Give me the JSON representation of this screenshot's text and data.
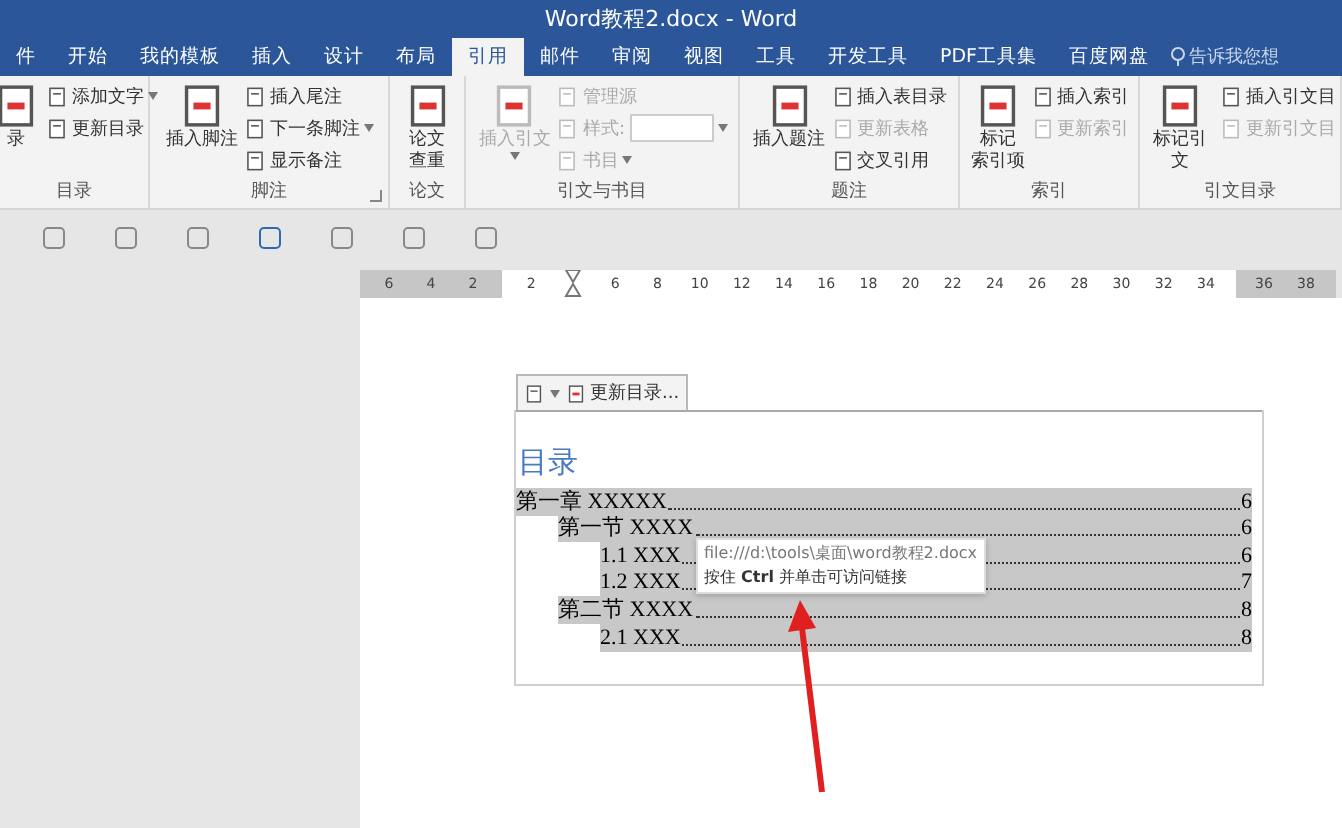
{
  "window": {
    "title": "Word教程2.docx - Word"
  },
  "tabs": [
    {
      "label": "件",
      "selected": false
    },
    {
      "label": "开始",
      "selected": false
    },
    {
      "label": "我的模板",
      "selected": false
    },
    {
      "label": "插入",
      "selected": false
    },
    {
      "label": "设计",
      "selected": false
    },
    {
      "label": "布局",
      "selected": false
    },
    {
      "label": "引用",
      "selected": true
    },
    {
      "label": "邮件",
      "selected": false
    },
    {
      "label": "审阅",
      "selected": false
    },
    {
      "label": "视图",
      "selected": false
    },
    {
      "label": "工具",
      "selected": false
    },
    {
      "label": "开发工具",
      "selected": false
    },
    {
      "label": "PDF工具集",
      "selected": false
    },
    {
      "label": "百度网盘",
      "selected": false
    }
  ],
  "tell_me": {
    "label": "告诉我您想"
  },
  "ribbon": {
    "groups": [
      {
        "label": "目录",
        "launcher": false,
        "items": [
          {
            "kind": "large",
            "lines": [
              "录"
            ],
            "disabled": false,
            "dropdown": false
          },
          {
            "kind": "small",
            "lines": [
              "添加文字"
            ],
            "disabled": false,
            "dropdown": true
          },
          {
            "kind": "small",
            "lines": [
              "更新目录"
            ],
            "disabled": false,
            "dropdown": false
          }
        ]
      },
      {
        "label": "脚注",
        "launcher": true,
        "items": [
          {
            "kind": "large",
            "lines": [
              "插入脚注"
            ],
            "disabled": false,
            "dropdown": false
          },
          {
            "kind": "small",
            "lines": [
              "插入尾注"
            ],
            "disabled": false,
            "dropdown": false
          },
          {
            "kind": "small",
            "lines": [
              "下一条脚注"
            ],
            "disabled": false,
            "dropdown": true
          },
          {
            "kind": "small",
            "lines": [
              "显示备注"
            ],
            "disabled": false,
            "dropdown": false
          }
        ]
      },
      {
        "label": "论文",
        "launcher": false,
        "items": [
          {
            "kind": "large",
            "lines": [
              "论文",
              "查重"
            ],
            "disabled": false,
            "dropdown": false
          }
        ]
      },
      {
        "label": "引文与书目",
        "launcher": false,
        "items": [
          {
            "kind": "large",
            "lines": [
              "插入引文"
            ],
            "disabled": true,
            "dropdown": true
          },
          {
            "kind": "small",
            "lines": [
              "管理源"
            ],
            "disabled": true,
            "dropdown": false
          },
          {
            "kind": "combo",
            "lines": [
              "样式:"
            ],
            "disabled": true,
            "dropdown": true
          },
          {
            "kind": "small",
            "lines": [
              "书目"
            ],
            "disabled": true,
            "dropdown": true
          }
        ]
      },
      {
        "label": "题注",
        "launcher": false,
        "items": [
          {
            "kind": "large",
            "lines": [
              "插入题注"
            ],
            "disabled": false,
            "dropdown": false
          },
          {
            "kind": "small",
            "lines": [
              "插入表目录"
            ],
            "disabled": false,
            "dropdown": false
          },
          {
            "kind": "small",
            "lines": [
              "更新表格"
            ],
            "disabled": true,
            "dropdown": false
          },
          {
            "kind": "small",
            "lines": [
              "交叉引用"
            ],
            "disabled": false,
            "dropdown": false
          }
        ]
      },
      {
        "label": "索引",
        "launcher": false,
        "items": [
          {
            "kind": "large",
            "lines": [
              "标记",
              "索引项"
            ],
            "disabled": false,
            "dropdown": false
          },
          {
            "kind": "small",
            "lines": [
              "插入索引"
            ],
            "disabled": false,
            "dropdown": false
          },
          {
            "kind": "small",
            "lines": [
              "更新索引"
            ],
            "disabled": true,
            "dropdown": false
          }
        ]
      },
      {
        "label": "引文目录",
        "launcher": false,
        "items": [
          {
            "kind": "large",
            "lines": [
              "标记引文"
            ],
            "disabled": false,
            "dropdown": false
          },
          {
            "kind": "small",
            "lines": [
              "插入引文目"
            ],
            "disabled": false,
            "dropdown": false
          },
          {
            "kind": "small",
            "lines": [
              "更新引文目"
            ],
            "disabled": true,
            "dropdown": false
          }
        ]
      }
    ]
  },
  "ruler": {
    "left_ticks": [
      "6",
      "4",
      "2"
    ],
    "ticks": [
      "2",
      "6",
      "8",
      "10",
      "12",
      "14",
      "16",
      "18",
      "20",
      "22",
      "24",
      "26",
      "28",
      "30",
      "32",
      "34"
    ],
    "right_ticks": [
      "36",
      "38"
    ]
  },
  "document": {
    "toc_toolbar": {
      "label": "更新目录..."
    },
    "heading": "目录",
    "toc": [
      {
        "text": "第一章  XXXXX",
        "page": "6",
        "children": [
          {
            "text": "第一节  XXXX",
            "page": "6",
            "children": [
              {
                "text": "1.1 XXX",
                "page": "6"
              },
              {
                "text": "1.2 XXX",
                "page": "7"
              }
            ]
          },
          {
            "text": "第二节  XXXX",
            "page": "8",
            "children": [
              {
                "text": "2.1 XXX",
                "page": "8"
              }
            ]
          }
        ]
      }
    ],
    "tooltip": {
      "path": "file:///d:\\tools\\桌面\\word教程2.docx",
      "hint": "按住 **Ctrl** 并单击可访问链接"
    }
  }
}
